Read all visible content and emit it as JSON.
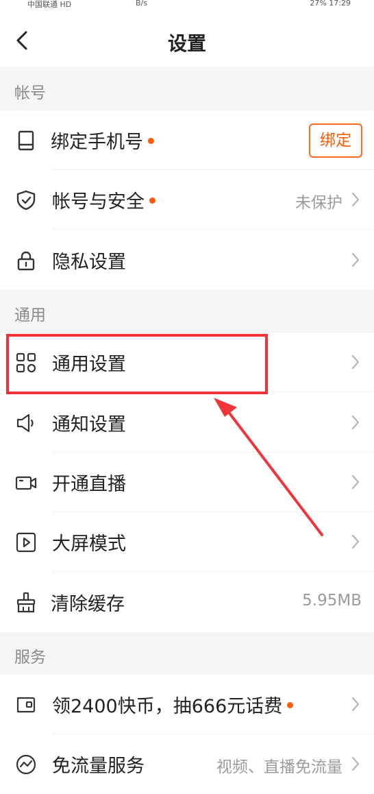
{
  "status_bar": {
    "carrier": "中国联通 HD",
    "speed": "B/s",
    "right": "27%   17:29"
  },
  "header": {
    "title": "设置"
  },
  "sections": {
    "account": "帐号",
    "general": "通用",
    "services": "服务"
  },
  "rows": {
    "bind_phone": {
      "label": "绑定手机号",
      "button": "绑定",
      "icon": "phone-icon"
    },
    "account_security": {
      "label": "帐号与安全",
      "value": "未保护",
      "icon": "shield-icon"
    },
    "privacy": {
      "label": "隐私设置",
      "icon": "lock-icon"
    },
    "general_settings": {
      "label": "通用设置",
      "icon": "grid-icon"
    },
    "notification": {
      "label": "通知设置",
      "icon": "speaker-icon"
    },
    "live": {
      "label": "开通直播",
      "icon": "camera-icon"
    },
    "bigscreen": {
      "label": "大屏模式",
      "icon": "play-icon"
    },
    "clear_cache": {
      "label": "清除缓存",
      "value": "5.95MB",
      "icon": "broom-icon"
    },
    "coins": {
      "label": "领2400快币，抽666元话费",
      "icon": "wallet-icon"
    },
    "free_data": {
      "label": "免流量服务",
      "value": "视频、直播免流量",
      "icon": "activity-icon"
    }
  },
  "colors": {
    "accent": "#ff5b06",
    "highlight": "#f0343a"
  }
}
